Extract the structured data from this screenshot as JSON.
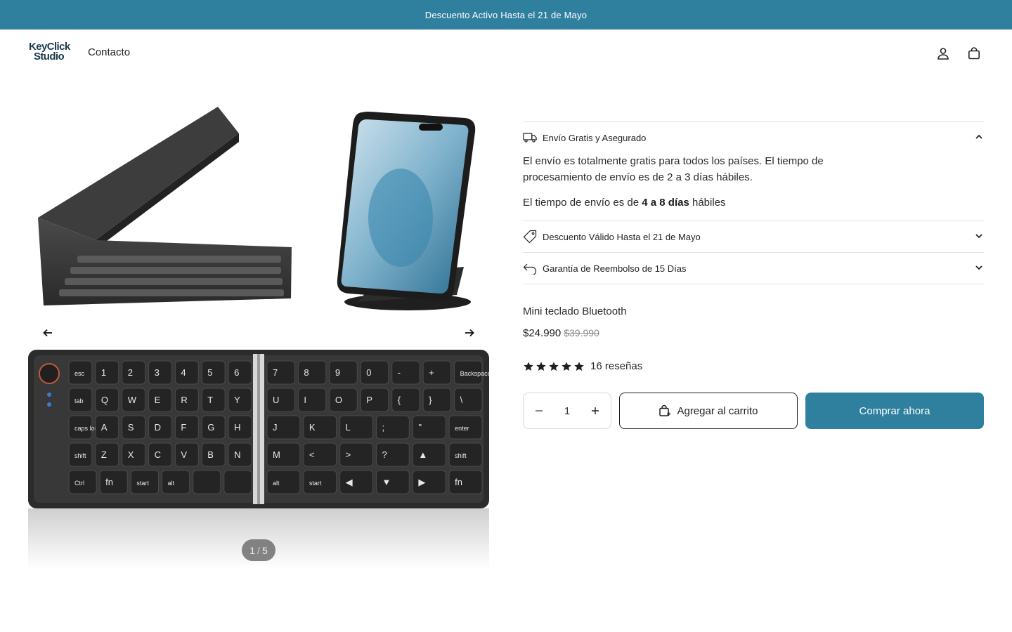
{
  "announcement": {
    "text": "Descuento Activo Hasta el 21 de Mayo"
  },
  "header": {
    "logo_line1": "KeyClick",
    "logo_line2": "Studio",
    "nav_contact": "Contacto",
    "account_icon": "user-icon",
    "cart_icon": "shopping-bag-icon"
  },
  "gallery": {
    "counter_current": "1",
    "counter_separator": "/",
    "counter_total": "5",
    "prev_icon": "arrow-left-icon",
    "next_icon": "arrow-right-icon",
    "keys_row1": [
      "esc",
      "1",
      "2",
      "3",
      "4",
      "5",
      "6",
      "7",
      "8",
      "9",
      "0",
      "-",
      "+",
      "Backspace"
    ],
    "keys_row2": [
      "tab",
      "Q",
      "W",
      "E",
      "R",
      "T",
      "Y",
      "U",
      "I",
      "O",
      "P",
      "{",
      "}",
      "\\"
    ],
    "keys_row3": [
      "caps lock",
      "A",
      "S",
      "D",
      "F",
      "G",
      "H",
      "J",
      "K",
      "L",
      ";",
      "\"",
      "enter"
    ],
    "keys_row4": [
      "shift",
      "Z",
      "X",
      "C",
      "V",
      "B",
      "N",
      "M",
      "<",
      ">",
      "?",
      "▲",
      "shift"
    ],
    "keys_row5": [
      "Ctrl",
      "fn",
      "start",
      "alt",
      "",
      "",
      "alt",
      "start",
      "◀",
      "▼",
      "▶",
      "fn"
    ]
  },
  "accordion": [
    {
      "icon": "truck-icon",
      "title": "Envío Gratis y Asegurado",
      "expanded": true,
      "chevron": "chevron-up-icon",
      "body_p1": "El envío es totalmente gratis para todos los países. El tiempo de procesamiento de envío es de 2 a 3 días hábiles.",
      "body_p2_prefix": "El tiempo de envío es de ",
      "body_p2_bold": "4 a 8 días",
      "body_p2_suffix": " hábiles"
    },
    {
      "icon": "price-tag-icon",
      "title": "Descuento Válido Hasta el 21 de Mayo",
      "expanded": false,
      "chevron": "chevron-down-icon"
    },
    {
      "icon": "return-arrow-icon",
      "title": "Garantía de Reembolso de 15 Días",
      "expanded": false,
      "chevron": "chevron-down-icon"
    }
  ],
  "product": {
    "title": "Mini teclado Bluetooth",
    "price": "$24.990",
    "compare_price": "$39.990",
    "rating_stars": 5,
    "reviews_text": "16 reseñas",
    "quantity": "1",
    "add_to_cart": "Agregar al carrito",
    "buy_now": "Comprar ahora"
  },
  "colors": {
    "brand": "#2f7f9e",
    "text": "#1f1f1f",
    "border": "#e3e3e3"
  }
}
